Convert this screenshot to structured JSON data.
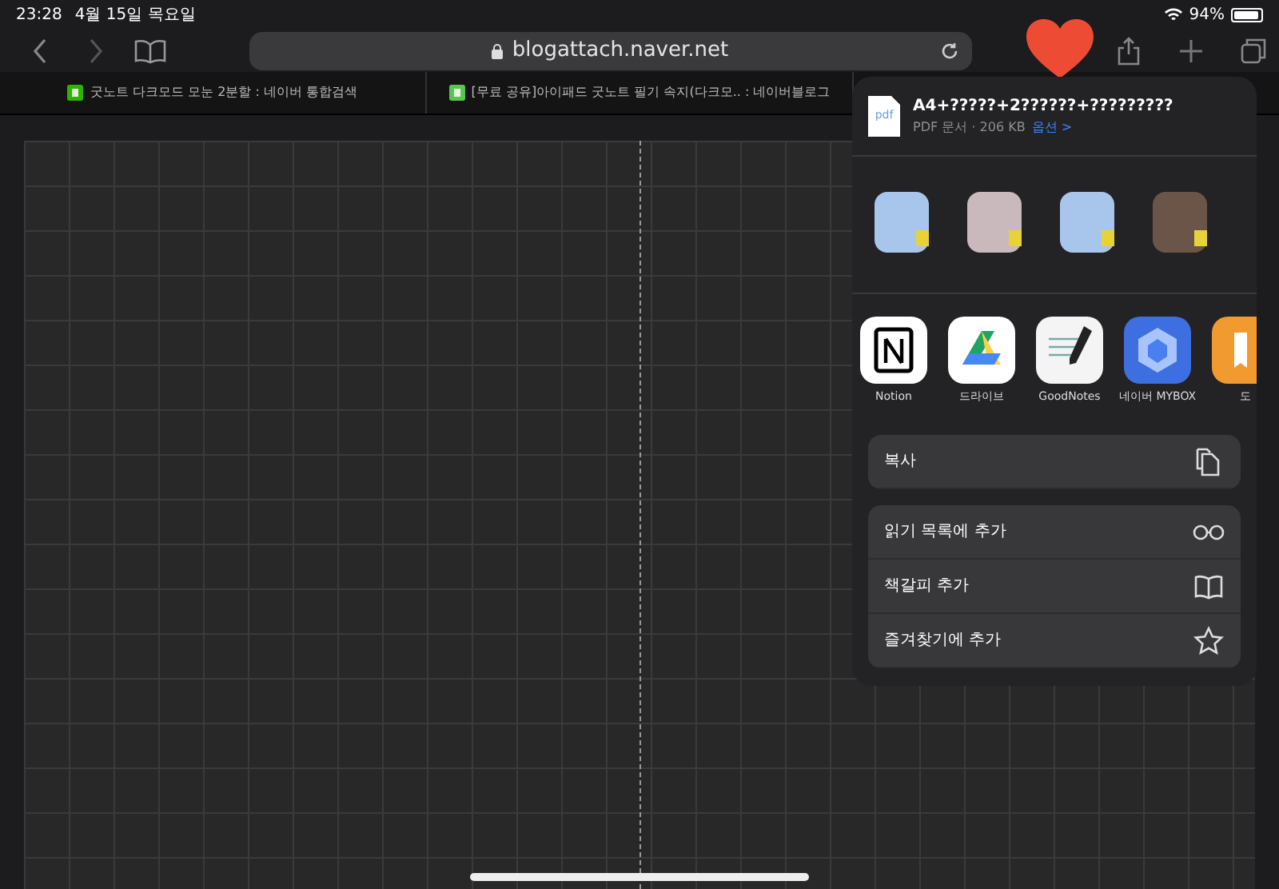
{
  "status_bar": {
    "time": "23:28",
    "date": "4월 15일 목요일",
    "battery": "94%"
  },
  "toolbar": {
    "url": "blogattach.naver.net"
  },
  "tabs": [
    {
      "title": "굿노트 다크모드 모눈 2분할 : 네이버 통합검색",
      "kind": "search",
      "selected": false
    },
    {
      "title": "[무료 공유]아이패드 굿노트 필기 속지(다크모.. : 네이버블로그",
      "kind": "blog",
      "selected": false
    }
  ],
  "share_sheet": {
    "file_icon_text": "pdf",
    "file_title": "A4+?????+2??????+?????????",
    "file_info": "PDF 문서 · 206 KB",
    "options_link": "옵션 >",
    "contacts": [
      {
        "color": "#a8c6ec"
      },
      {
        "color": "#c9b8bc"
      },
      {
        "color": "#a8c6ec"
      },
      {
        "color": "#6b5548"
      }
    ],
    "apps": [
      {
        "label": "Notion",
        "kind": "notion"
      },
      {
        "label": "드라이브",
        "kind": "drive"
      },
      {
        "label": "GoodNotes",
        "kind": "goodnotes"
      },
      {
        "label": "네이버 MYBOX",
        "kind": "mybox"
      },
      {
        "label": "도",
        "kind": "books"
      }
    ],
    "action_groups": [
      [
        {
          "label": "복사",
          "kind": "copy"
        }
      ],
      [
        {
          "label": "읽기 목록에 추가",
          "kind": "reading-list"
        },
        {
          "label": "책갈피 추가",
          "kind": "bookmark"
        },
        {
          "label": "즐겨찾기에 추가",
          "kind": "favorite"
        }
      ]
    ]
  }
}
